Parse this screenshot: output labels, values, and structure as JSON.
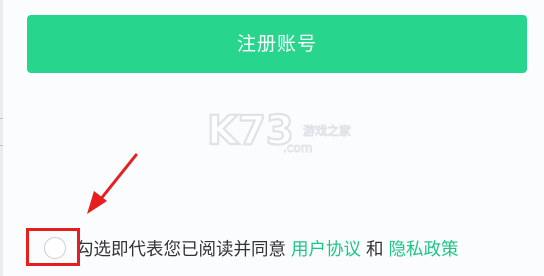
{
  "register": {
    "label": "注册账号"
  },
  "watermark": {
    "logo": "K73",
    "site_cn": "游戏之家",
    "domain": ".com"
  },
  "agreement": {
    "consent_text": "勾选即代表您已阅读并同意",
    "user_agreement": "用户协议",
    "and": "和",
    "privacy_policy": "隐私政策"
  },
  "colors": {
    "primary_green": "#27d58c",
    "link_green": "#20c487",
    "annotation_red": "#e61e1e"
  },
  "icons": {
    "checkbox": "circle-checkbox-icon",
    "arrow": "red-arrow-annotation-icon"
  }
}
